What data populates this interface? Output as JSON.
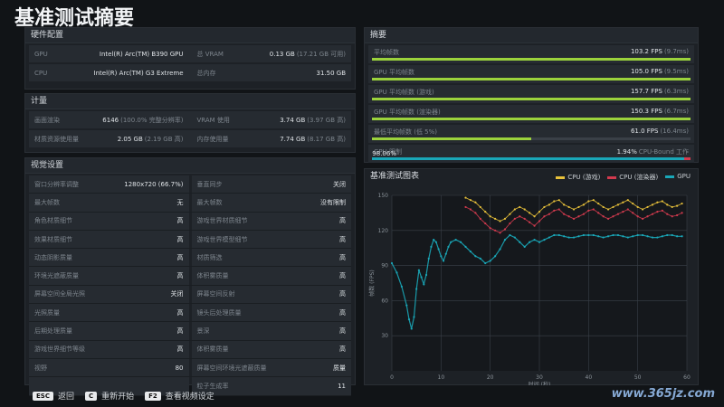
{
  "page_title": "基准测试摘要",
  "hardware": {
    "title": "硬件配置",
    "rows": [
      [
        {
          "label": "GPU",
          "value": "Intel(R) Arc(TM) B390 GPU",
          "sub": ""
        },
        {
          "label": "总 VRAM",
          "value": "0.13 GB",
          "sub": "(17.21 GB 可用)"
        }
      ],
      [
        {
          "label": "CPU",
          "value": "Intel(R) Arc(TM) G3 Extreme",
          "sub": ""
        },
        {
          "label": "总内存",
          "value": "31.50 GB",
          "sub": ""
        }
      ]
    ]
  },
  "metrics": {
    "title": "计量",
    "rows": [
      [
        {
          "label": "画面渲染",
          "value": "6146",
          "sub": "(100.0% 完整分辨率)"
        },
        {
          "label": "VRAM 使用",
          "value": "3.74 GB",
          "sub": "(3.97 GB 高)"
        }
      ],
      [
        {
          "label": "材质资源使用量",
          "value": "2.05 GB",
          "sub": "(2.19 GB 高)"
        },
        {
          "label": "内存使用量",
          "value": "7.74 GB",
          "sub": "(8.17 GB 高)"
        }
      ]
    ]
  },
  "settings": {
    "title": "视觉设置",
    "rows": [
      [
        {
          "label": "窗口分辨率调整",
          "value": "1280x720 (66.7%)"
        },
        {
          "label": "垂直同步",
          "value": "关闭"
        }
      ],
      [
        {
          "label": "最大帧数",
          "value": "无"
        },
        {
          "label": "最大帧数",
          "value": "没有限制"
        }
      ],
      [
        {
          "label": "角色材质细节",
          "value": "高"
        },
        {
          "label": "游戏世界材质细节",
          "value": "高"
        }
      ],
      [
        {
          "label": "效果材质细节",
          "value": "高"
        },
        {
          "label": "游戏世界模型细节",
          "value": "高"
        }
      ],
      [
        {
          "label": "动态阴影质量",
          "value": "高"
        },
        {
          "label": "材质筛选",
          "value": "高"
        }
      ],
      [
        {
          "label": "环境光遮蔽质量",
          "value": "高"
        },
        {
          "label": "体积雾质量",
          "value": "高"
        }
      ],
      [
        {
          "label": "屏幕空间全局光照",
          "value": "关闭"
        },
        {
          "label": "屏幕空间反射",
          "value": "高"
        }
      ],
      [
        {
          "label": "光照质量",
          "value": "高"
        },
        {
          "label": "镜头后处理质量",
          "value": "高"
        }
      ],
      [
        {
          "label": "后期处理质量",
          "value": "高"
        },
        {
          "label": "景深",
          "value": "高"
        }
      ],
      [
        {
          "label": "游戏世界细节等级",
          "value": "高"
        },
        {
          "label": "体积雾质量",
          "value": "高"
        }
      ],
      [
        {
          "label": "视野",
          "value": "80"
        },
        {
          "label": "屏幕空间环境光遮蔽质量",
          "value": "质量"
        }
      ],
      [
        {
          "label": "",
          "value": ""
        },
        {
          "label": "粒子生成率",
          "value": "11"
        }
      ]
    ]
  },
  "summary": {
    "title": "摘要",
    "rows": [
      {
        "label": "平均帧数",
        "value": "103.2 FPS",
        "sub": "(9.7ms)",
        "fill": 1.0,
        "color": "#9bd23c"
      },
      {
        "label": "GPU 平均帧数",
        "value": "105.0 FPS",
        "sub": "(9.5ms)",
        "fill": 1.0,
        "color": "#9bd23c"
      },
      {
        "label": "GPU 平均帧数 (游戏)",
        "value": "157.7 FPS",
        "sub": "(6.3ms)",
        "fill": 1.0,
        "color": "#9bd23c"
      },
      {
        "label": "GPU 平均帧数 (渲染器)",
        "value": "150.3 FPS",
        "sub": "(6.7ms)",
        "fill": 1.0,
        "color": "#9bd23c"
      },
      {
        "label": "最低平均帧数 (低 5%)",
        "value": "61.0 FPS",
        "sub": "(16.4ms)",
        "fill": 0.5,
        "color": "#9bd23c"
      }
    ],
    "gpu_limit": {
      "label": "GPU 限制",
      "percent": "98.06%",
      "right": "1.94%",
      "right_label": "CPU-Bound 工作",
      "fill": 0.98,
      "color": "#19a7b8",
      "rest_color": "#d23a4e"
    }
  },
  "chart_title": "基准测试图表",
  "chart_data": {
    "type": "scatter",
    "title": "基准测试图表",
    "xlabel": "时间 (秒)",
    "ylabel": "帧数 (FPS)",
    "xlim": [
      0,
      60
    ],
    "ylim": [
      0,
      150
    ],
    "xticks": [
      "0",
      "10",
      "20",
      "30",
      "40",
      "50",
      "60"
    ],
    "yticks": [
      "30",
      "60",
      "90",
      "120",
      "150"
    ],
    "grid": true,
    "legend_position": "top-right",
    "series": [
      {
        "name": "CPU (游戏)",
        "color": "#e8c13a",
        "points": [
          [
            15,
            148
          ],
          [
            16,
            146
          ],
          [
            17,
            144
          ],
          [
            18,
            140
          ],
          [
            19,
            136
          ],
          [
            20,
            132
          ],
          [
            21,
            130
          ],
          [
            22,
            128
          ],
          [
            23,
            130
          ],
          [
            24,
            134
          ],
          [
            25,
            138
          ],
          [
            26,
            140
          ],
          [
            27,
            138
          ],
          [
            28,
            135
          ],
          [
            29,
            132
          ],
          [
            30,
            136
          ],
          [
            31,
            140
          ],
          [
            32,
            142
          ],
          [
            33,
            145
          ],
          [
            34,
            146
          ],
          [
            35,
            142
          ],
          [
            36,
            140
          ],
          [
            37,
            138
          ],
          [
            38,
            140
          ],
          [
            39,
            142
          ],
          [
            40,
            145
          ],
          [
            41,
            146
          ],
          [
            42,
            143
          ],
          [
            43,
            140
          ],
          [
            44,
            138
          ],
          [
            45,
            140
          ],
          [
            46,
            142
          ],
          [
            47,
            144
          ],
          [
            48,
            146
          ],
          [
            49,
            143
          ],
          [
            50,
            140
          ],
          [
            51,
            138
          ],
          [
            52,
            140
          ],
          [
            53,
            142
          ],
          [
            54,
            144
          ],
          [
            55,
            145
          ],
          [
            56,
            142
          ],
          [
            57,
            140
          ],
          [
            58,
            141
          ],
          [
            59,
            143
          ]
        ]
      },
      {
        "name": "CPU (渲染器)",
        "color": "#d23a4e",
        "points": [
          [
            15,
            140
          ],
          [
            16,
            138
          ],
          [
            17,
            135
          ],
          [
            18,
            130
          ],
          [
            19,
            126
          ],
          [
            20,
            122
          ],
          [
            21,
            120
          ],
          [
            22,
            118
          ],
          [
            23,
            121
          ],
          [
            24,
            126
          ],
          [
            25,
            130
          ],
          [
            26,
            132
          ],
          [
            27,
            130
          ],
          [
            28,
            127
          ],
          [
            29,
            124
          ],
          [
            30,
            128
          ],
          [
            31,
            132
          ],
          [
            32,
            134
          ],
          [
            33,
            137
          ],
          [
            34,
            138
          ],
          [
            35,
            134
          ],
          [
            36,
            132
          ],
          [
            37,
            130
          ],
          [
            38,
            132
          ],
          [
            39,
            134
          ],
          [
            40,
            137
          ],
          [
            41,
            138
          ],
          [
            42,
            135
          ],
          [
            43,
            132
          ],
          [
            44,
            130
          ],
          [
            45,
            132
          ],
          [
            46,
            134
          ],
          [
            47,
            136
          ],
          [
            48,
            138
          ],
          [
            49,
            135
          ],
          [
            50,
            132
          ],
          [
            51,
            130
          ],
          [
            52,
            132
          ],
          [
            53,
            134
          ],
          [
            54,
            136
          ],
          [
            55,
            137
          ],
          [
            56,
            134
          ],
          [
            57,
            132
          ],
          [
            58,
            133
          ],
          [
            59,
            135
          ]
        ]
      },
      {
        "name": "GPU",
        "color": "#19a7b8",
        "points": [
          [
            0,
            92
          ],
          [
            1,
            84
          ],
          [
            2,
            72
          ],
          [
            3,
            56
          ],
          [
            3.5,
            44
          ],
          [
            4,
            36
          ],
          [
            4.5,
            46
          ],
          [
            5,
            70
          ],
          [
            5.5,
            86
          ],
          [
            6,
            80
          ],
          [
            6.5,
            74
          ],
          [
            7,
            82
          ],
          [
            7.5,
            96
          ],
          [
            8,
            106
          ],
          [
            8.5,
            112
          ],
          [
            9,
            110
          ],
          [
            9.5,
            104
          ],
          [
            10,
            98
          ],
          [
            10.5,
            94
          ],
          [
            11,
            100
          ],
          [
            11.5,
            106
          ],
          [
            12,
            110
          ],
          [
            13,
            112
          ],
          [
            14,
            110
          ],
          [
            15,
            106
          ],
          [
            16,
            102
          ],
          [
            17,
            98
          ],
          [
            18,
            96
          ],
          [
            19,
            92
          ],
          [
            20,
            94
          ],
          [
            21,
            98
          ],
          [
            22,
            104
          ],
          [
            23,
            112
          ],
          [
            24,
            116
          ],
          [
            25,
            114
          ],
          [
            26,
            110
          ],
          [
            27,
            106
          ],
          [
            28,
            110
          ],
          [
            29,
            112
          ],
          [
            30,
            110
          ],
          [
            31,
            112
          ],
          [
            32,
            114
          ],
          [
            33,
            116
          ],
          [
            34,
            116
          ],
          [
            35,
            115
          ],
          [
            36,
            114
          ],
          [
            37,
            114
          ],
          [
            38,
            115
          ],
          [
            39,
            116
          ],
          [
            40,
            116
          ],
          [
            41,
            116
          ],
          [
            42,
            115
          ],
          [
            43,
            114
          ],
          [
            44,
            115
          ],
          [
            45,
            116
          ],
          [
            46,
            116
          ],
          [
            47,
            115
          ],
          [
            48,
            114
          ],
          [
            49,
            115
          ],
          [
            50,
            116
          ],
          [
            51,
            116
          ],
          [
            52,
            115
          ],
          [
            53,
            114
          ],
          [
            54,
            114
          ],
          [
            55,
            115
          ],
          [
            56,
            116
          ],
          [
            57,
            116
          ],
          [
            58,
            115
          ],
          [
            59,
            115
          ]
        ]
      }
    ]
  },
  "footer": [
    {
      "key": "ESC",
      "label": "返回"
    },
    {
      "key": "C",
      "label": "重新开始"
    },
    {
      "key": "F2",
      "label": "查看视频设定"
    }
  ],
  "watermark": "www.365jz.com"
}
